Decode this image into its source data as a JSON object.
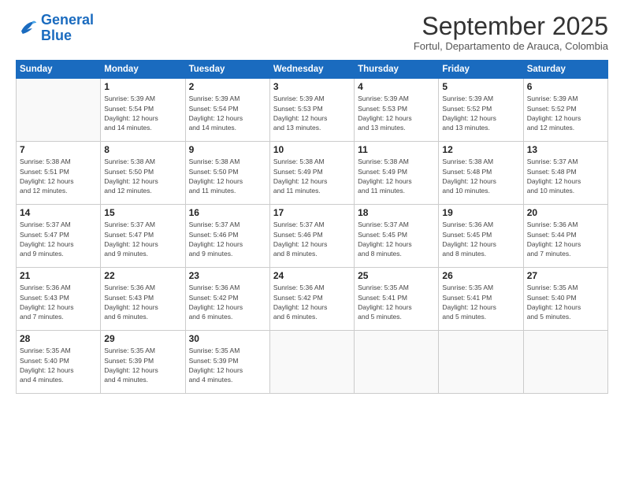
{
  "logo": {
    "line1": "General",
    "line2": "Blue"
  },
  "title": "September 2025",
  "location": "Fortul, Departamento de Arauca, Colombia",
  "weekdays": [
    "Sunday",
    "Monday",
    "Tuesday",
    "Wednesday",
    "Thursday",
    "Friday",
    "Saturday"
  ],
  "weeks": [
    [
      {
        "day": "",
        "info": ""
      },
      {
        "day": "1",
        "info": "Sunrise: 5:39 AM\nSunset: 5:54 PM\nDaylight: 12 hours\nand 14 minutes."
      },
      {
        "day": "2",
        "info": "Sunrise: 5:39 AM\nSunset: 5:54 PM\nDaylight: 12 hours\nand 14 minutes."
      },
      {
        "day": "3",
        "info": "Sunrise: 5:39 AM\nSunset: 5:53 PM\nDaylight: 12 hours\nand 13 minutes."
      },
      {
        "day": "4",
        "info": "Sunrise: 5:39 AM\nSunset: 5:53 PM\nDaylight: 12 hours\nand 13 minutes."
      },
      {
        "day": "5",
        "info": "Sunrise: 5:39 AM\nSunset: 5:52 PM\nDaylight: 12 hours\nand 13 minutes."
      },
      {
        "day": "6",
        "info": "Sunrise: 5:39 AM\nSunset: 5:52 PM\nDaylight: 12 hours\nand 12 minutes."
      }
    ],
    [
      {
        "day": "7",
        "info": "Sunrise: 5:38 AM\nSunset: 5:51 PM\nDaylight: 12 hours\nand 12 minutes."
      },
      {
        "day": "8",
        "info": "Sunrise: 5:38 AM\nSunset: 5:50 PM\nDaylight: 12 hours\nand 12 minutes."
      },
      {
        "day": "9",
        "info": "Sunrise: 5:38 AM\nSunset: 5:50 PM\nDaylight: 12 hours\nand 11 minutes."
      },
      {
        "day": "10",
        "info": "Sunrise: 5:38 AM\nSunset: 5:49 PM\nDaylight: 12 hours\nand 11 minutes."
      },
      {
        "day": "11",
        "info": "Sunrise: 5:38 AM\nSunset: 5:49 PM\nDaylight: 12 hours\nand 11 minutes."
      },
      {
        "day": "12",
        "info": "Sunrise: 5:38 AM\nSunset: 5:48 PM\nDaylight: 12 hours\nand 10 minutes."
      },
      {
        "day": "13",
        "info": "Sunrise: 5:37 AM\nSunset: 5:48 PM\nDaylight: 12 hours\nand 10 minutes."
      }
    ],
    [
      {
        "day": "14",
        "info": "Sunrise: 5:37 AM\nSunset: 5:47 PM\nDaylight: 12 hours\nand 9 minutes."
      },
      {
        "day": "15",
        "info": "Sunrise: 5:37 AM\nSunset: 5:47 PM\nDaylight: 12 hours\nand 9 minutes."
      },
      {
        "day": "16",
        "info": "Sunrise: 5:37 AM\nSunset: 5:46 PM\nDaylight: 12 hours\nand 9 minutes."
      },
      {
        "day": "17",
        "info": "Sunrise: 5:37 AM\nSunset: 5:46 PM\nDaylight: 12 hours\nand 8 minutes."
      },
      {
        "day": "18",
        "info": "Sunrise: 5:37 AM\nSunset: 5:45 PM\nDaylight: 12 hours\nand 8 minutes."
      },
      {
        "day": "19",
        "info": "Sunrise: 5:36 AM\nSunset: 5:45 PM\nDaylight: 12 hours\nand 8 minutes."
      },
      {
        "day": "20",
        "info": "Sunrise: 5:36 AM\nSunset: 5:44 PM\nDaylight: 12 hours\nand 7 minutes."
      }
    ],
    [
      {
        "day": "21",
        "info": "Sunrise: 5:36 AM\nSunset: 5:43 PM\nDaylight: 12 hours\nand 7 minutes."
      },
      {
        "day": "22",
        "info": "Sunrise: 5:36 AM\nSunset: 5:43 PM\nDaylight: 12 hours\nand 6 minutes."
      },
      {
        "day": "23",
        "info": "Sunrise: 5:36 AM\nSunset: 5:42 PM\nDaylight: 12 hours\nand 6 minutes."
      },
      {
        "day": "24",
        "info": "Sunrise: 5:36 AM\nSunset: 5:42 PM\nDaylight: 12 hours\nand 6 minutes."
      },
      {
        "day": "25",
        "info": "Sunrise: 5:35 AM\nSunset: 5:41 PM\nDaylight: 12 hours\nand 5 minutes."
      },
      {
        "day": "26",
        "info": "Sunrise: 5:35 AM\nSunset: 5:41 PM\nDaylight: 12 hours\nand 5 minutes."
      },
      {
        "day": "27",
        "info": "Sunrise: 5:35 AM\nSunset: 5:40 PM\nDaylight: 12 hours\nand 5 minutes."
      }
    ],
    [
      {
        "day": "28",
        "info": "Sunrise: 5:35 AM\nSunset: 5:40 PM\nDaylight: 12 hours\nand 4 minutes."
      },
      {
        "day": "29",
        "info": "Sunrise: 5:35 AM\nSunset: 5:39 PM\nDaylight: 12 hours\nand 4 minutes."
      },
      {
        "day": "30",
        "info": "Sunrise: 5:35 AM\nSunset: 5:39 PM\nDaylight: 12 hours\nand 4 minutes."
      },
      {
        "day": "",
        "info": ""
      },
      {
        "day": "",
        "info": ""
      },
      {
        "day": "",
        "info": ""
      },
      {
        "day": "",
        "info": ""
      }
    ]
  ]
}
